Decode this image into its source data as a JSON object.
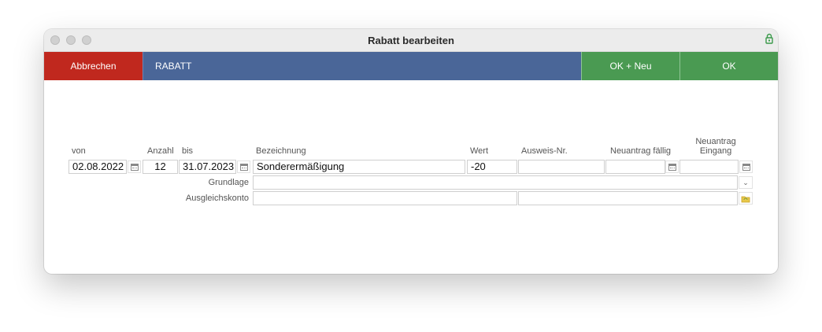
{
  "window": {
    "title": "Rabatt bearbeiten"
  },
  "toolbar": {
    "cancel_label": "Abbrechen",
    "section_label": "RABATT",
    "ok_new_label": "OK + Neu",
    "ok_label": "OK"
  },
  "labels": {
    "von": "von",
    "anzahl": "Anzahl",
    "bis": "bis",
    "bezeichnung": "Bezeichnung",
    "wert": "Wert",
    "ausweis_nr": "Ausweis-Nr.",
    "neuantrag_faellig": "Neuantrag fällig",
    "neuantrag_eingang_line1": "Neuantrag",
    "neuantrag_eingang_line2": "Eingang",
    "grundlage": "Grundlage",
    "ausgleichskonto": "Ausgleichskonto"
  },
  "values": {
    "von": "02.08.2022",
    "anzahl": "12",
    "bis": "31.07.2023",
    "bezeichnung": "Sonderermäßigung",
    "wert": "-20",
    "ausweis_nr": "",
    "neuantrag_faellig": "",
    "neuantrag_eingang": "",
    "grundlage": "",
    "ausgleichskonto_1": "",
    "ausgleichskonto_2": ""
  },
  "icons": {
    "lock": "lock-icon",
    "calendar": "calendar-icon",
    "dropdown": "chevron-down-icon",
    "account_lookup": "folder-lookup-icon"
  },
  "colors": {
    "cancel": "#c0281e",
    "section": "#4a6698",
    "ok": "#4a9a52",
    "lock": "#3a9a4a"
  }
}
